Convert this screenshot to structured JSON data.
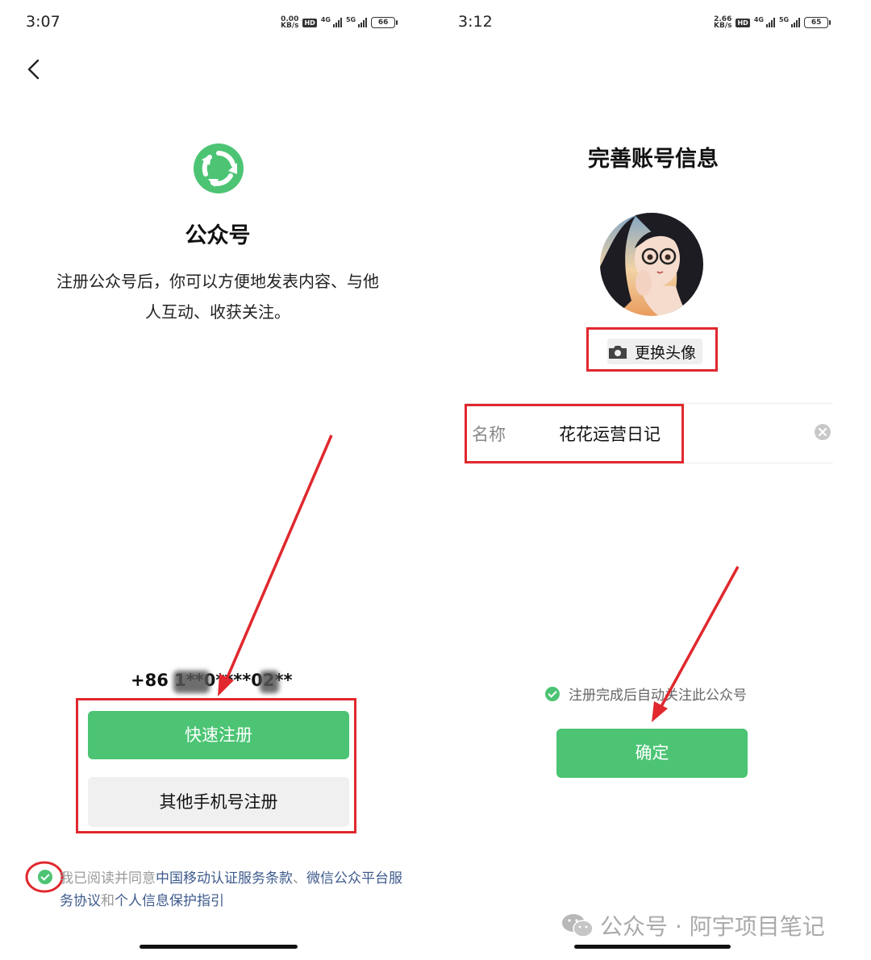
{
  "left": {
    "status": {
      "time": "3:07",
      "speed_value": "0.00",
      "speed_unit": "KB/s",
      "hd": "HD",
      "net1": "4G",
      "net2": "5G",
      "battery": "66"
    },
    "app_name": "公众号",
    "description_line1": "注册公众号后，你可以方便地发表内容、与他",
    "description_line2": "人互动、收获关注。",
    "phone": "+86 1**0****02**",
    "quick_register_label": "快速注册",
    "other_phone_label": "其他手机号注册",
    "agreement": {
      "prefix": "我已阅读并同意",
      "link1": "中国移动认证服务条款",
      "sep": "、",
      "link2": "微信公众平台服务协议",
      "and": "和",
      "link3": "个人信息保护指引"
    }
  },
  "right": {
    "status": {
      "time": "3:12",
      "speed_value": "2.66",
      "speed_unit": "KB/s",
      "hd": "HD",
      "net1": "4G",
      "net2": "5G",
      "battery": "65"
    },
    "title": "完善账号信息",
    "change_avatar_label": "更换头像",
    "name_label": "名称",
    "name_value": "花花运营日记",
    "follow_text": "注册完成后自动关注此公众号",
    "confirm_label": "确定"
  },
  "watermark": "公众号 · 阿宇项目笔记",
  "colors": {
    "accent": "#4cc474",
    "annotation": "#e0282e",
    "link": "#3e5a8c"
  }
}
